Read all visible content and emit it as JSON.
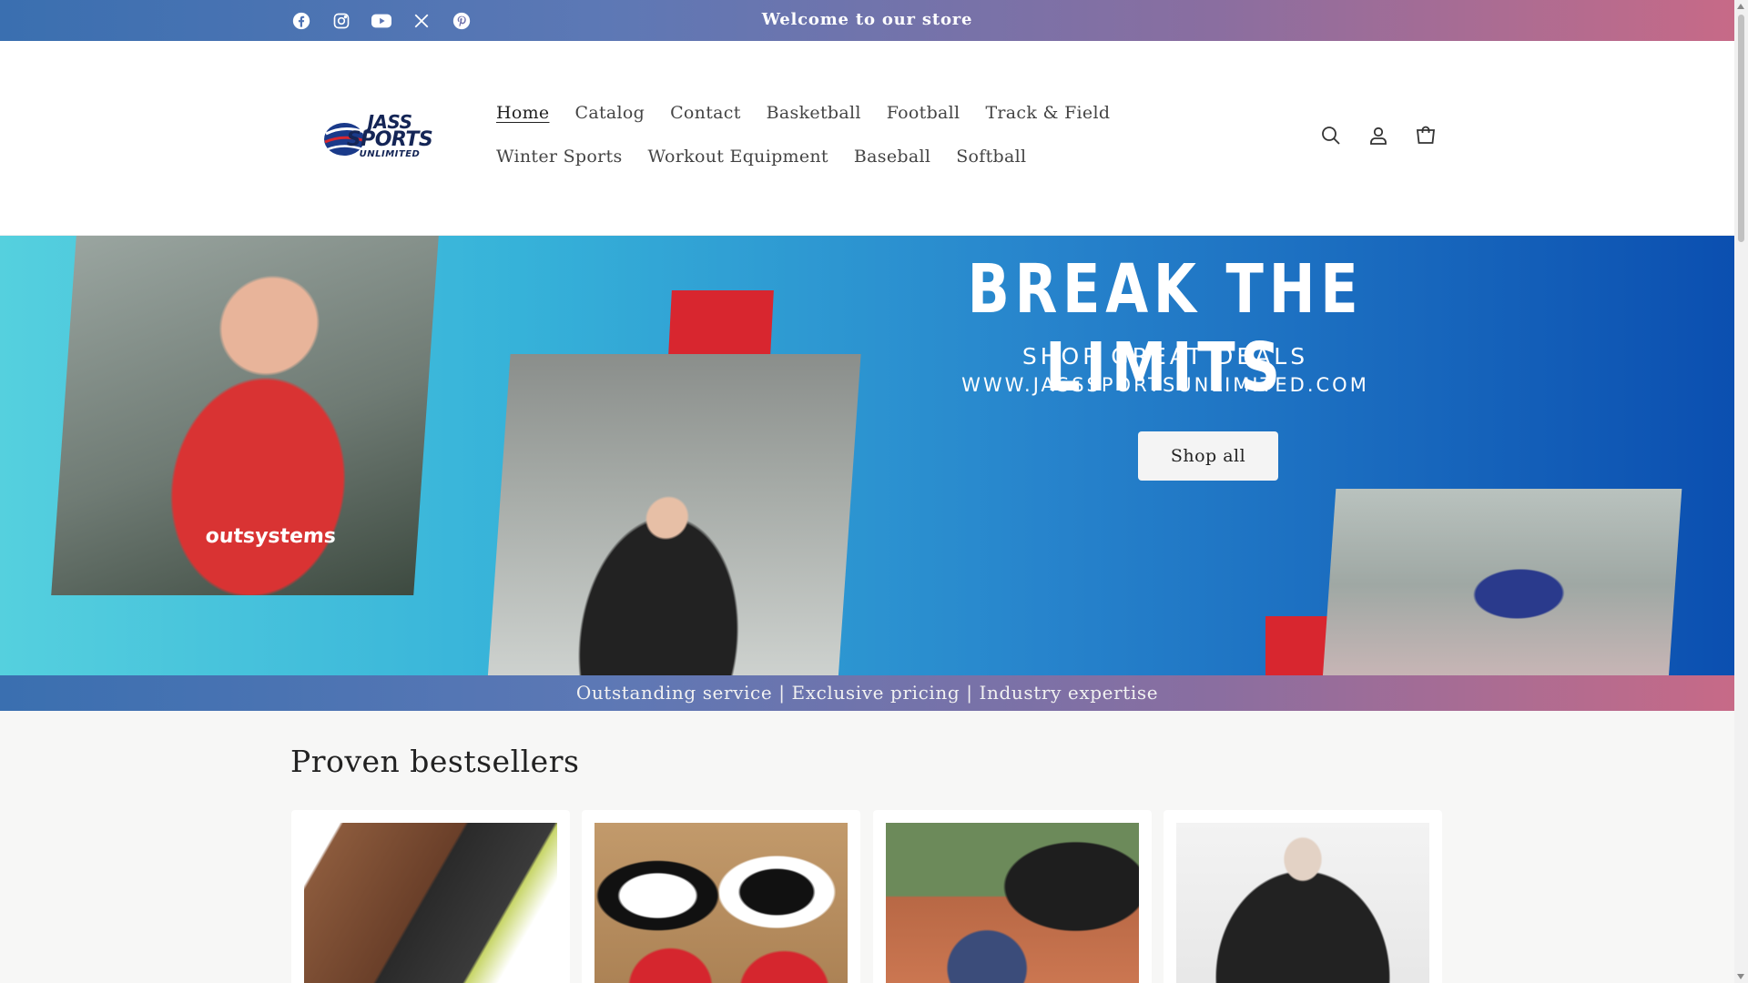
{
  "announcement": {
    "text": "Welcome to our store",
    "social": [
      {
        "icon": "facebook-icon"
      },
      {
        "icon": "instagram-icon"
      },
      {
        "icon": "youtube-icon"
      },
      {
        "icon": "x-icon"
      },
      {
        "icon": "pinterest-icon"
      }
    ]
  },
  "header": {
    "logo": {
      "line1": "JASS",
      "line2": "SPORTS",
      "line3": "UNLIMITED"
    },
    "nav": [
      {
        "label": "Home",
        "active": true
      },
      {
        "label": "Catalog"
      },
      {
        "label": "Contact"
      },
      {
        "label": "Basketball"
      },
      {
        "label": "Football"
      },
      {
        "label": "Track & Field"
      },
      {
        "label": "Winter Sports"
      },
      {
        "label": "Workout Equipment"
      },
      {
        "label": "Baseball"
      },
      {
        "label": "Softball"
      }
    ],
    "icons": [
      "search-icon",
      "account-icon",
      "cart-icon"
    ]
  },
  "hero": {
    "title": "BREAK THE LIMITS",
    "subtitle": "SHOP GREAT DEALS",
    "url": "WWW.JASSSPORTSUNLIMITED.COM",
    "photo1_text": "outsystems",
    "cta": "Shop all"
  },
  "tagline": "Outstanding service | Exclusive pricing | Industry expertise",
  "bestsellers": {
    "title": "Proven bestsellers"
  },
  "colors": {
    "gradient_start": "#3a6fb0",
    "gradient_end": "#c76a87",
    "hero_red": "#d8262f",
    "logo_navy": "#142556"
  }
}
